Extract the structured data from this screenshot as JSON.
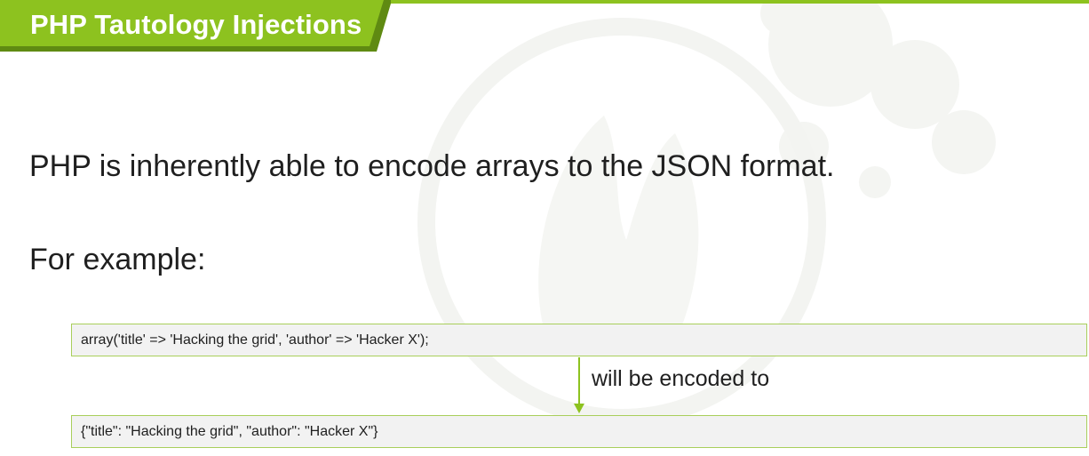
{
  "slide": {
    "title": "PHP Tautology Injections",
    "intro": "PHP is inherently able to encode arrays to the JSON format.",
    "example_label": "For example:",
    "code_input": "array('title' => 'Hacking the grid',   'author' => 'Hacker X');",
    "arrow_label": "will be encoded to",
    "code_output": "{\"title\": \"Hacking the grid\", \"author\":   \"Hacker X\"}"
  },
  "colors": {
    "accent": "#8dc21f",
    "tab_shadow": "#5f8a12",
    "code_background": "#f2f2f2",
    "code_border": "#a9cf5b",
    "text": "#1f1f1f"
  },
  "icons": {
    "arrow": "arrow-down-icon"
  }
}
